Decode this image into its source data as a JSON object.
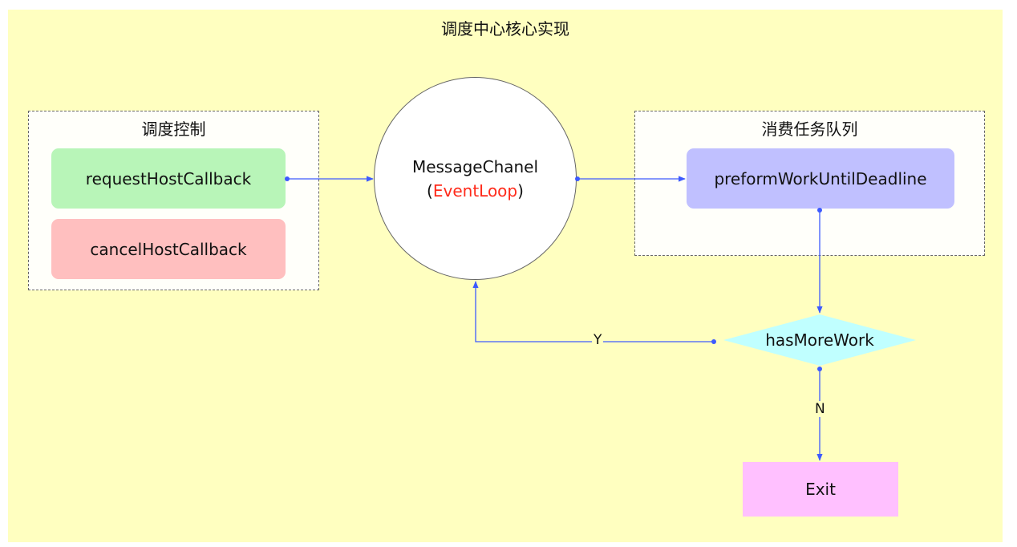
{
  "title": "调度中心核心实现",
  "groups": {
    "control": {
      "label": "调度控制"
    },
    "consume": {
      "label": "消费任务队列"
    }
  },
  "nodes": {
    "request": {
      "label": "requestHostCallback",
      "color": "#b8f5b8"
    },
    "cancel": {
      "label": "cancelHostCallback",
      "color": "#ffbfbf"
    },
    "message": {
      "line1": "MessageChanel",
      "open": "(",
      "highlight": "EventLoop",
      "close": ")",
      "highlight_color": "#ff2a1a"
    },
    "perform": {
      "label": "preformWorkUntilDeadline",
      "color": "#c0c0ff"
    },
    "decision": {
      "label": "hasMoreWork",
      "color": "#c0ffff"
    },
    "exit": {
      "label": "Exit",
      "color": "#ffc0ff"
    }
  },
  "edges": {
    "yes_label": "Y",
    "no_label": "N",
    "color": "#3d5afe"
  }
}
